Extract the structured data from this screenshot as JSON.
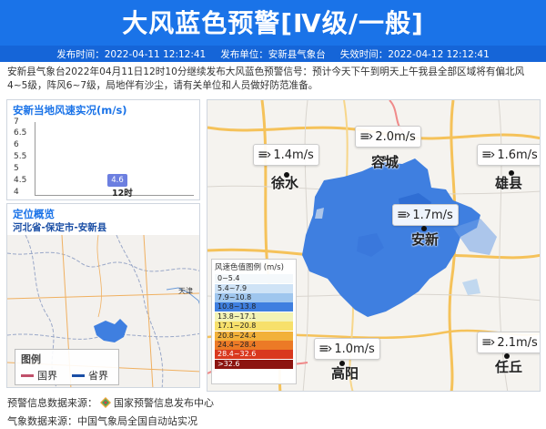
{
  "header": {
    "title": "大风蓝色预警[Ⅳ级/一般]",
    "publish_time": "发布时间：2022-04-11 12:12:41",
    "publisher": "发布单位：安新县气象台",
    "expire_time": "失效时间：2022-04-12 12:12:41"
  },
  "description": "安新县气象台2022年04月11日12时10分继续发布大风蓝色预警信号：预计今天下午到明天上午我县全部区域将有偏北风4~5级，阵风6~7级，局地伴有沙尘，请有关单位和人员做好防范准备。",
  "speed_panel": {
    "title": "安新当地风速实况(m/s)",
    "y_ticks": [
      "7",
      "6.5",
      "6",
      "5.5",
      "5",
      "4.5",
      "4"
    ],
    "x_tick": "12时"
  },
  "chart_data": {
    "type": "scatter",
    "title": "安新当地风速实况(m/s)",
    "categories": [
      "12时"
    ],
    "values": [
      4.6
    ],
    "ylim": [
      4,
      7
    ]
  },
  "locate_panel": {
    "title": "定位概览",
    "path": "河北省-保定市-安新县",
    "legend_title": "图例",
    "legend_items": [
      {
        "label": "国界",
        "color": "#c0506a"
      },
      {
        "label": "省界",
        "color": "#1a4ea5"
      }
    ],
    "city_label": "天津"
  },
  "stations": [
    {
      "name": "徐水",
      "speed": "1.4m/s"
    },
    {
      "name": "容城",
      "speed": "2.0m/s"
    },
    {
      "name": "雄县",
      "speed": "1.6m/s"
    },
    {
      "name": "安新",
      "speed": "1.7m/s"
    },
    {
      "name": "高阳",
      "speed": "1.0m/s"
    },
    {
      "name": "任丘",
      "speed": "2.1m/s"
    }
  ],
  "scale_legend": {
    "title": "风速色值图例 (m/s)",
    "items": [
      {
        "label": "0~5.4",
        "color": "#f4f8fb"
      },
      {
        "label": "5.4~7.9",
        "color": "#cfe3f6"
      },
      {
        "label": "7.9~10.8",
        "color": "#9fc6ee"
      },
      {
        "label": "10.8~13.8",
        "color": "#3f7fe0"
      },
      {
        "label": "13.8~17.1",
        "color": "#f3f3b5"
      },
      {
        "label": "17.1~20.8",
        "color": "#f7e06b"
      },
      {
        "label": "20.8~24.4",
        "color": "#f2b13a"
      },
      {
        "label": "24.4~28.4",
        "color": "#ec7a26"
      },
      {
        "label": "28.4~32.6",
        "color": "#d9381e"
      },
      {
        "label": ">32.6",
        "color": "#8c1410"
      }
    ]
  },
  "footer": {
    "warning_source_label": "预警信息数据来源：",
    "warning_source": "国家预警信息发布中心",
    "weather_source": "气象数据来源：中国气象局全国自动站实况"
  },
  "colors": {
    "header": "#1a73e8",
    "accent": "#1a73e8",
    "warning_area": "#3f7fe0"
  }
}
